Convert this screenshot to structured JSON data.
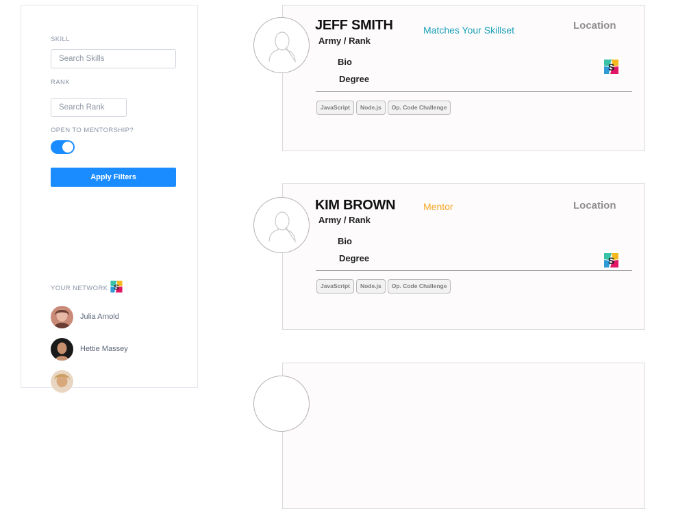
{
  "filters": {
    "skill_label": "SKILL",
    "skill_placeholder": "Search Skills",
    "rank_label": "RANK",
    "rank_placeholder": "Search Rank",
    "mentorship_label": "OPEN TO MENTORSHIP?",
    "mentorship_enabled": true,
    "apply_label": "Apply Filters"
  },
  "network": {
    "title": "YOUR NETWORK",
    "icon": "slack-icon",
    "people": [
      {
        "name": "Julia Arnold"
      },
      {
        "name": "Hettie Massey"
      },
      {
        "name": ""
      }
    ]
  },
  "profiles": [
    {
      "name": "JEFF SMITH",
      "rank": "Army / Rank",
      "status": "Matches Your Skillset",
      "location": "Location",
      "bio": "Bio",
      "degree": "Degree",
      "tags": [
        "JavaScript",
        "Node.js",
        "Op. Code Challenge"
      ]
    },
    {
      "name": "KIM BROWN",
      "rank": "Army / Rank",
      "status": "Mentor",
      "location": "Location",
      "bio": "Bio",
      "degree": "Degree",
      "tags": [
        "JavaScript",
        "Node.js",
        "Op. Code Challenge"
      ]
    }
  ],
  "colors": {
    "accent": "#1a8cff",
    "match": "#1aa0b8",
    "mentor": "#f5a623"
  }
}
